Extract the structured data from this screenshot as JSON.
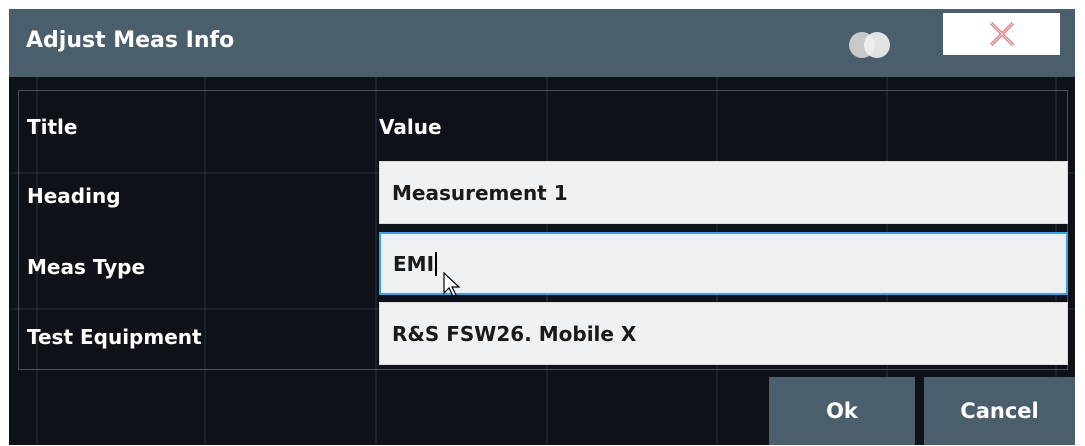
{
  "dialog": {
    "title": "Adjust Meas Info",
    "close_icon": "close-x-icon",
    "toggle_icon": "transparency-toggle-icon"
  },
  "table": {
    "col_title": "Title",
    "col_value": "Value",
    "rows": [
      {
        "label": "Heading",
        "value": "Measurement 1"
      },
      {
        "label": "Meas Type",
        "value": "EMI"
      },
      {
        "label": "Test Equipment",
        "value": "R&S FSW26. Mobile X"
      }
    ]
  },
  "buttons": {
    "ok": "Ok",
    "cancel": "Cancel"
  },
  "colors": {
    "titlebar": "#4b5e6c",
    "background": "#0e1218",
    "focus_border": "#3aa3e3"
  }
}
